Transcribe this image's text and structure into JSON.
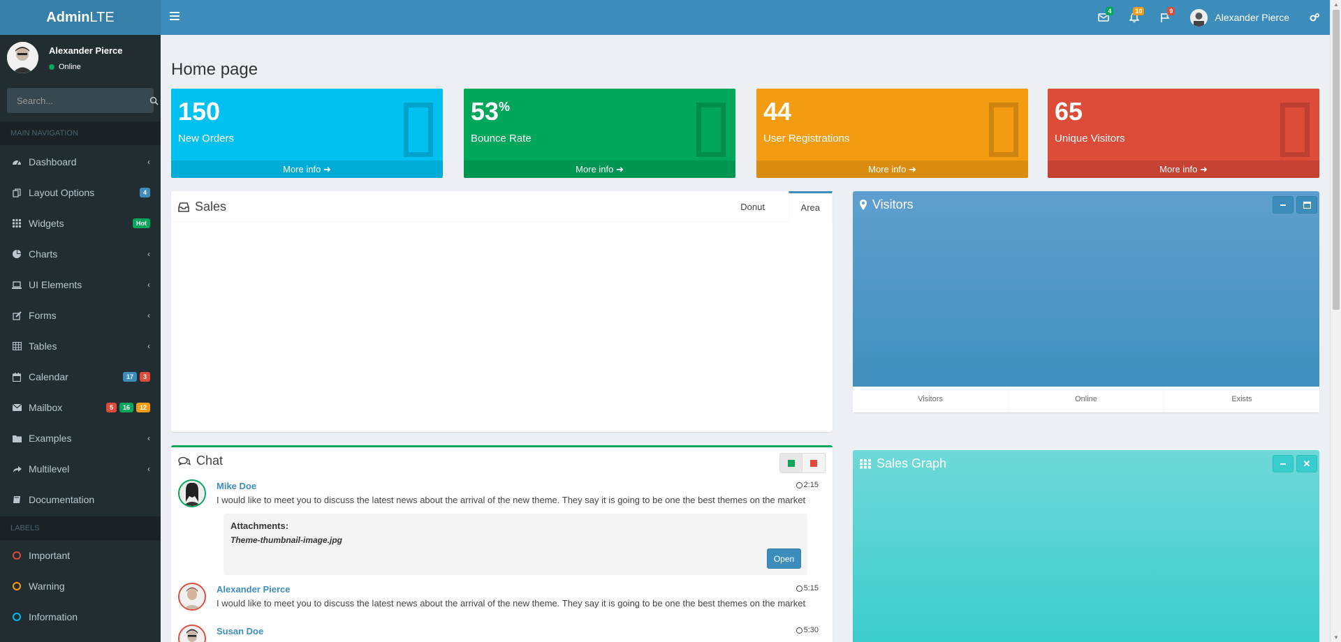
{
  "header": {
    "logo_bold": "Admin",
    "logo_light": "LTE",
    "messages_badge": "4",
    "notifications_badge": "10",
    "tasks_badge": "9",
    "user_name": "Alexander Pierce"
  },
  "sidebar": {
    "user": {
      "name": "Alexander Pierce",
      "status": "Online"
    },
    "search_placeholder": "Search...",
    "main_header": "MAIN NAVIGATION",
    "items": [
      {
        "label": "Dashboard",
        "icon": "dashboard-icon"
      },
      {
        "label": "Layout Options",
        "icon": "files-icon",
        "badges": [
          "4"
        ]
      },
      {
        "label": "Widgets",
        "icon": "th-icon",
        "badges": [
          "Hot"
        ]
      },
      {
        "label": "Charts",
        "icon": "pie-chart-icon"
      },
      {
        "label": "UI Elements",
        "icon": "laptop-icon"
      },
      {
        "label": "Forms",
        "icon": "edit-icon"
      },
      {
        "label": "Tables",
        "icon": "table-icon"
      },
      {
        "label": "Calendar",
        "icon": "calendar-icon",
        "badges": [
          "17",
          "3"
        ]
      },
      {
        "label": "Mailbox",
        "icon": "envelope-icon",
        "badges": [
          "5",
          "16",
          "12"
        ]
      },
      {
        "label": "Examples",
        "icon": "folder-icon"
      },
      {
        "label": "Multilevel",
        "icon": "share-icon"
      },
      {
        "label": "Documentation",
        "icon": "book-icon"
      }
    ],
    "labels_header": "LABELS",
    "labels": [
      {
        "label": "Important",
        "color": "#dd4b39"
      },
      {
        "label": "Warning",
        "color": "#f39c12"
      },
      {
        "label": "Information",
        "color": "#00c0ef"
      }
    ]
  },
  "page": {
    "title": "Home page"
  },
  "stats": [
    {
      "value": "150",
      "sup": "",
      "label": "New Orders",
      "footer": "More info",
      "color": "#00c0ef"
    },
    {
      "value": "53",
      "sup": "%",
      "label": "Bounce Rate",
      "footer": "More info",
      "color": "#00a65a"
    },
    {
      "value": "44",
      "sup": "",
      "label": "User Registrations",
      "footer": "More info",
      "color": "#f39c12"
    },
    {
      "value": "65",
      "sup": "",
      "label": "Unique Visitors",
      "footer": "More info",
      "color": "#dd4b39"
    }
  ],
  "sales": {
    "title": "Sales",
    "tabs": [
      "Donut",
      "Area"
    ],
    "active_tab": "Area"
  },
  "visitors": {
    "title": "Visitors",
    "footer": [
      "Visitors",
      "Online",
      "Exists"
    ]
  },
  "chat": {
    "title": "Chat",
    "messages": [
      {
        "name": "Mike Doe",
        "time": "2:15",
        "text": "I would like to meet you to discuss the latest news about the arrival of the new theme. They say it is going to be one the best themes on the market",
        "border": "#00a65a"
      },
      {
        "name": "Alexander Pierce",
        "time": "5:15",
        "text": "I would like to meet you to discuss the latest news about the arrival of the new theme. They say it is going to be one the best themes on the market",
        "border": "#dd4b39"
      },
      {
        "name": "Susan Doe",
        "time": "5:30",
        "text": "",
        "border": "#dd4b39"
      }
    ],
    "attachment": {
      "heading": "Attachments:",
      "file": "Theme-thumbnail-image.jpg",
      "button": "Open"
    }
  },
  "sales_graph": {
    "title": "Sales Graph"
  }
}
